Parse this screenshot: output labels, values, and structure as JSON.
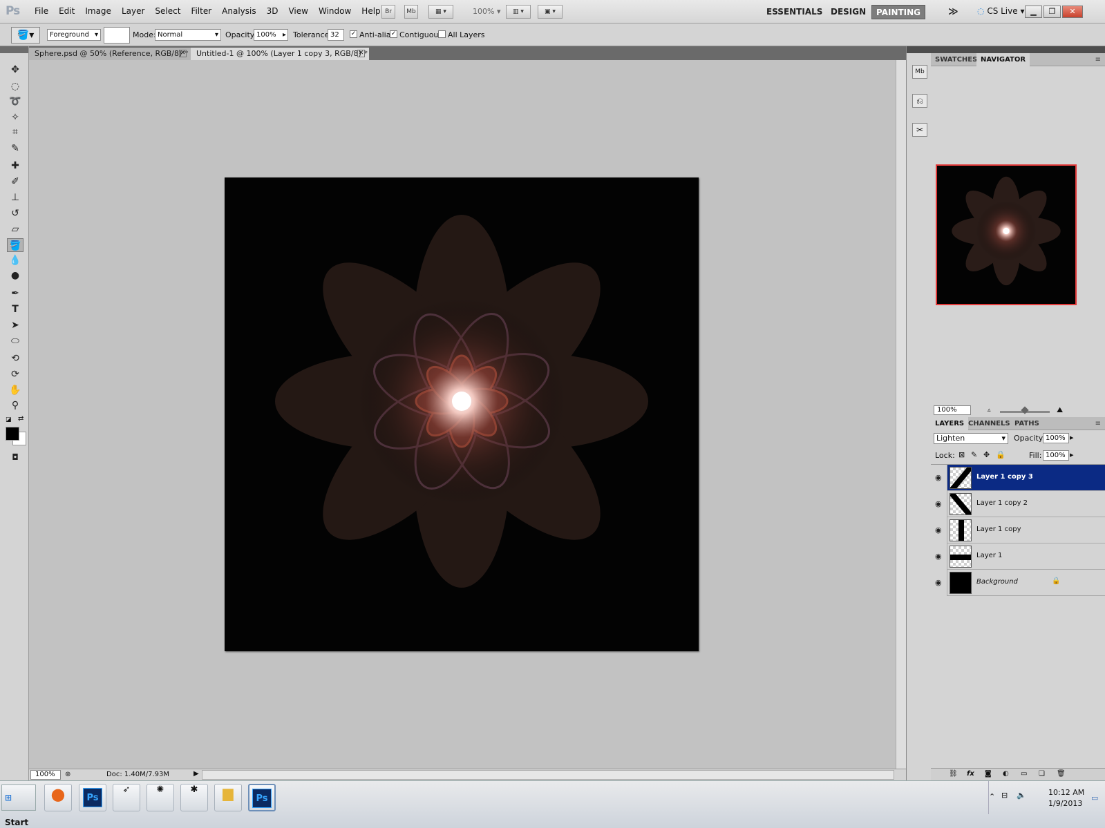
{
  "app": {
    "logo": "Ps"
  },
  "menu": [
    "File",
    "Edit",
    "Image",
    "Layer",
    "Select",
    "Filter",
    "Analysis",
    "3D",
    "View",
    "Window",
    "Help"
  ],
  "appbar": {
    "br": "Br",
    "mb": "Mb",
    "zoom": "100%"
  },
  "workspaces": {
    "essentials": "ESSENTIALS",
    "design": "DESIGN",
    "painting": "PAINTING",
    "more": "≫"
  },
  "cslive": "CS Live",
  "options": {
    "fill_source": "Foreground",
    "mode_label": "Mode:",
    "mode_value": "Normal",
    "opacity_label": "Opacity:",
    "opacity_value": "100%",
    "tolerance_label": "Tolerance:",
    "tolerance_value": "32",
    "antialias_label": "Anti-alias",
    "contiguous_label": "Contiguous",
    "all_layers_label": "All Layers"
  },
  "tabs": [
    {
      "label": "Sphere.psd @ 50% (Reference, RGB/8) *"
    },
    {
      "label": "Untitled-1 @ 100% (Layer 1 copy 3, RGB/8) *"
    }
  ],
  "status": {
    "zoom": "100%",
    "doc": "Doc: 1.40M/7.93M"
  },
  "dock": {
    "mb": "Mb"
  },
  "navigator_panel": {
    "tabs": [
      "SWATCHES",
      "NAVIGATOR"
    ],
    "zoom": "100%"
  },
  "layers_panel": {
    "tabs": [
      "LAYERS",
      "CHANNELS",
      "PATHS"
    ],
    "blend_mode": "Lighten",
    "opacity_label": "Opacity:",
    "opacity_value": "100%",
    "lock_label": "Lock:",
    "fill_label": "Fill:",
    "fill_value": "100%",
    "layers": [
      {
        "name": "Layer 1 copy 3",
        "active": true
      },
      {
        "name": "Layer 1 copy 2",
        "active": false
      },
      {
        "name": "Layer 1 copy",
        "active": false
      },
      {
        "name": "Layer 1",
        "active": false
      },
      {
        "name": "Background",
        "active": false,
        "locked": true
      }
    ]
  },
  "taskbar": {
    "start": "Start",
    "time": "10:12 AM",
    "date": "1/9/2013"
  },
  "colors": {
    "accent_selected": "#0b2a84",
    "nav_frame": "#e23a3a"
  }
}
